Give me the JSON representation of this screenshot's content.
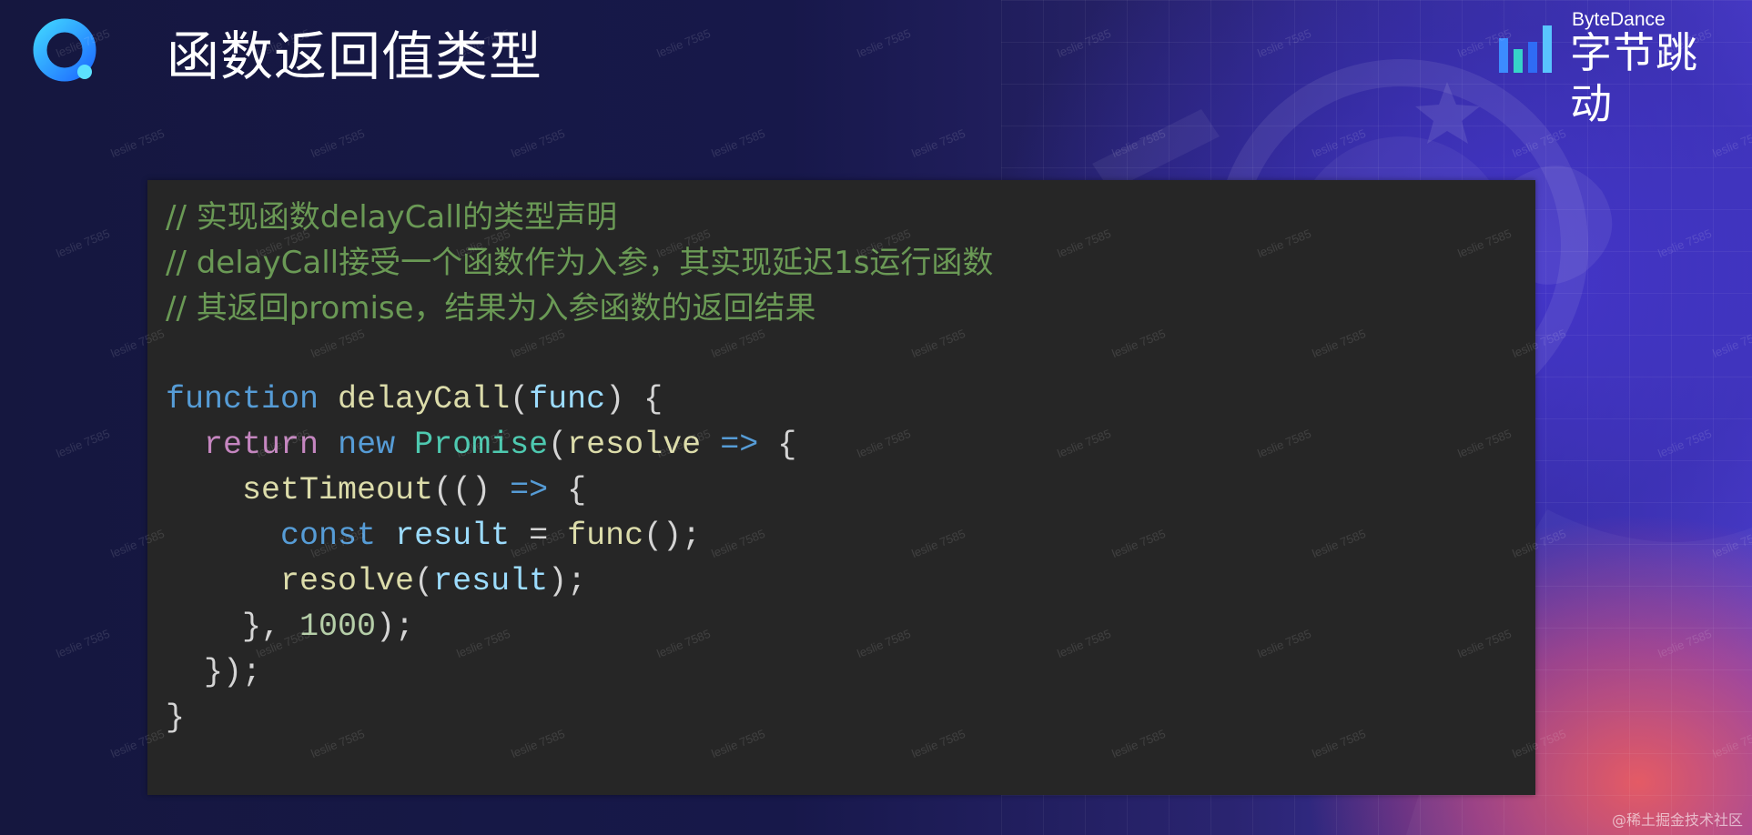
{
  "slide": {
    "title": "函数返回值类型"
  },
  "brand": {
    "en": "ByteDance",
    "cn": "字节跳动"
  },
  "colors": {
    "background": "#15173f",
    "panel": "#262626",
    "comment": "#6a9955",
    "keyword_blue": "#569cd6",
    "keyword_pink": "#c586c0",
    "function": "#dcdcaa",
    "variable": "#9cdcfe",
    "class": "#4ec9b0",
    "number": "#b5cea8",
    "text": "#d4d4d4"
  },
  "code": {
    "comments": [
      "// 实现函数delayCall的类型声明",
      "// delayCall接受一个函数作为入参，其实现延迟1s运行函数",
      "// 其返回promise，结果为入参函数的返回结果"
    ],
    "tokens": {
      "function": "function",
      "delayCall": "delayCall",
      "func": "func",
      "return": "return",
      "new": "new",
      "Promise": "Promise",
      "resolve": "resolve",
      "arrow": "=>",
      "setTimeout": "setTimeout",
      "const": "const",
      "result": "result",
      "num1000": "1000"
    }
  },
  "watermark": "leslie 7585",
  "credit": "@稀土掘金技术社区"
}
